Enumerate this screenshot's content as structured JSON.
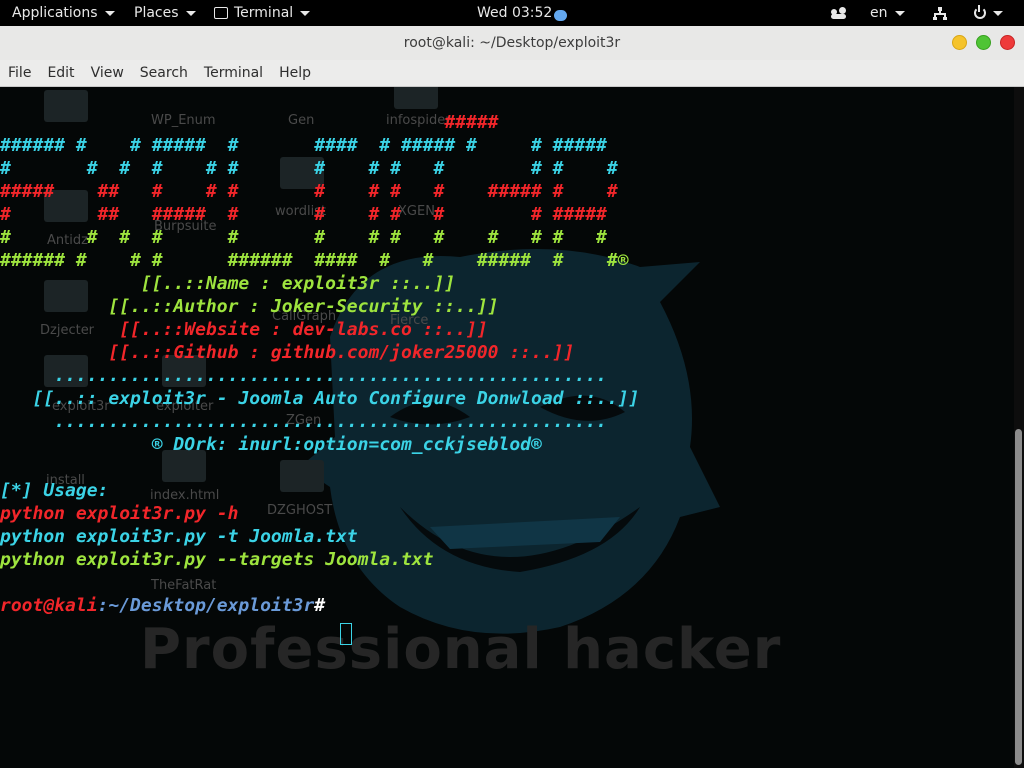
{
  "topbar": {
    "applications": "Applications",
    "places": "Places",
    "terminal": "Terminal",
    "clock": "Wed 03:52",
    "language": "en"
  },
  "window": {
    "title": "root@kali: ~/Desktop/exploit3r"
  },
  "menu": {
    "file": "File",
    "edit": "Edit",
    "view": "View",
    "search": "Search",
    "terminal": "Terminal",
    "help": "Help"
  },
  "desktop": {
    "icons": [
      "WP_Enum",
      "Gen",
      "infospider",
      "Antidz",
      "Burpsuite",
      "wordlist",
      "XGEN",
      "Dzjecter",
      "CallGraph",
      "Fierce",
      "exploiter",
      "ZGen",
      "exploit3r",
      "index.html",
      "DZGHOST",
      "install",
      "TheFatRat"
    ],
    "watermark": "Professional hacker"
  },
  "terminal": {
    "banner": [
      "                                         #####",
      "###### #    # #####  #       ####  # ##### #     # #####",
      "#       #  #  #    # #       #    # #   #        # #    #",
      "#####    ##   #    # #       #    # #   #    ##### #    #",
      "#        ##   #####  #       #    # #   #        # #####",
      "#       #  #  #      #       #    # #   #    #   # #   #",
      "###### #    # #      ######  ####  #   #    #####  #    #®"
    ],
    "name_line": "             [[..::Name : exploit3r ::..]]",
    "author_line": "          [[..::Author : Joker-Security ::..]]",
    "website_line": "           [[..::Website : dev-labs.co ::..]]",
    "github_line": "          [[..::Github : github.com/joker25000 ::..]]",
    "dots_line": "     ...................................................",
    "desc_line": "   [[..:: exploit3r - Joomla Auto Configure Donwload ::..]]",
    "dork_line": "              ® DOrk: inurl:option=com_cckjseblod®",
    "usage_label": "[*] Usage:",
    "usage_1": "python exploit3r.py -h",
    "usage_2": "python exploit3r.py -t Joomla.txt",
    "usage_3": "python exploit3r.py --targets Joomla.txt",
    "prompt_user": "root@kali",
    "prompt_path": ":~/Desktop/exploit3r",
    "prompt_symbol": "# "
  }
}
